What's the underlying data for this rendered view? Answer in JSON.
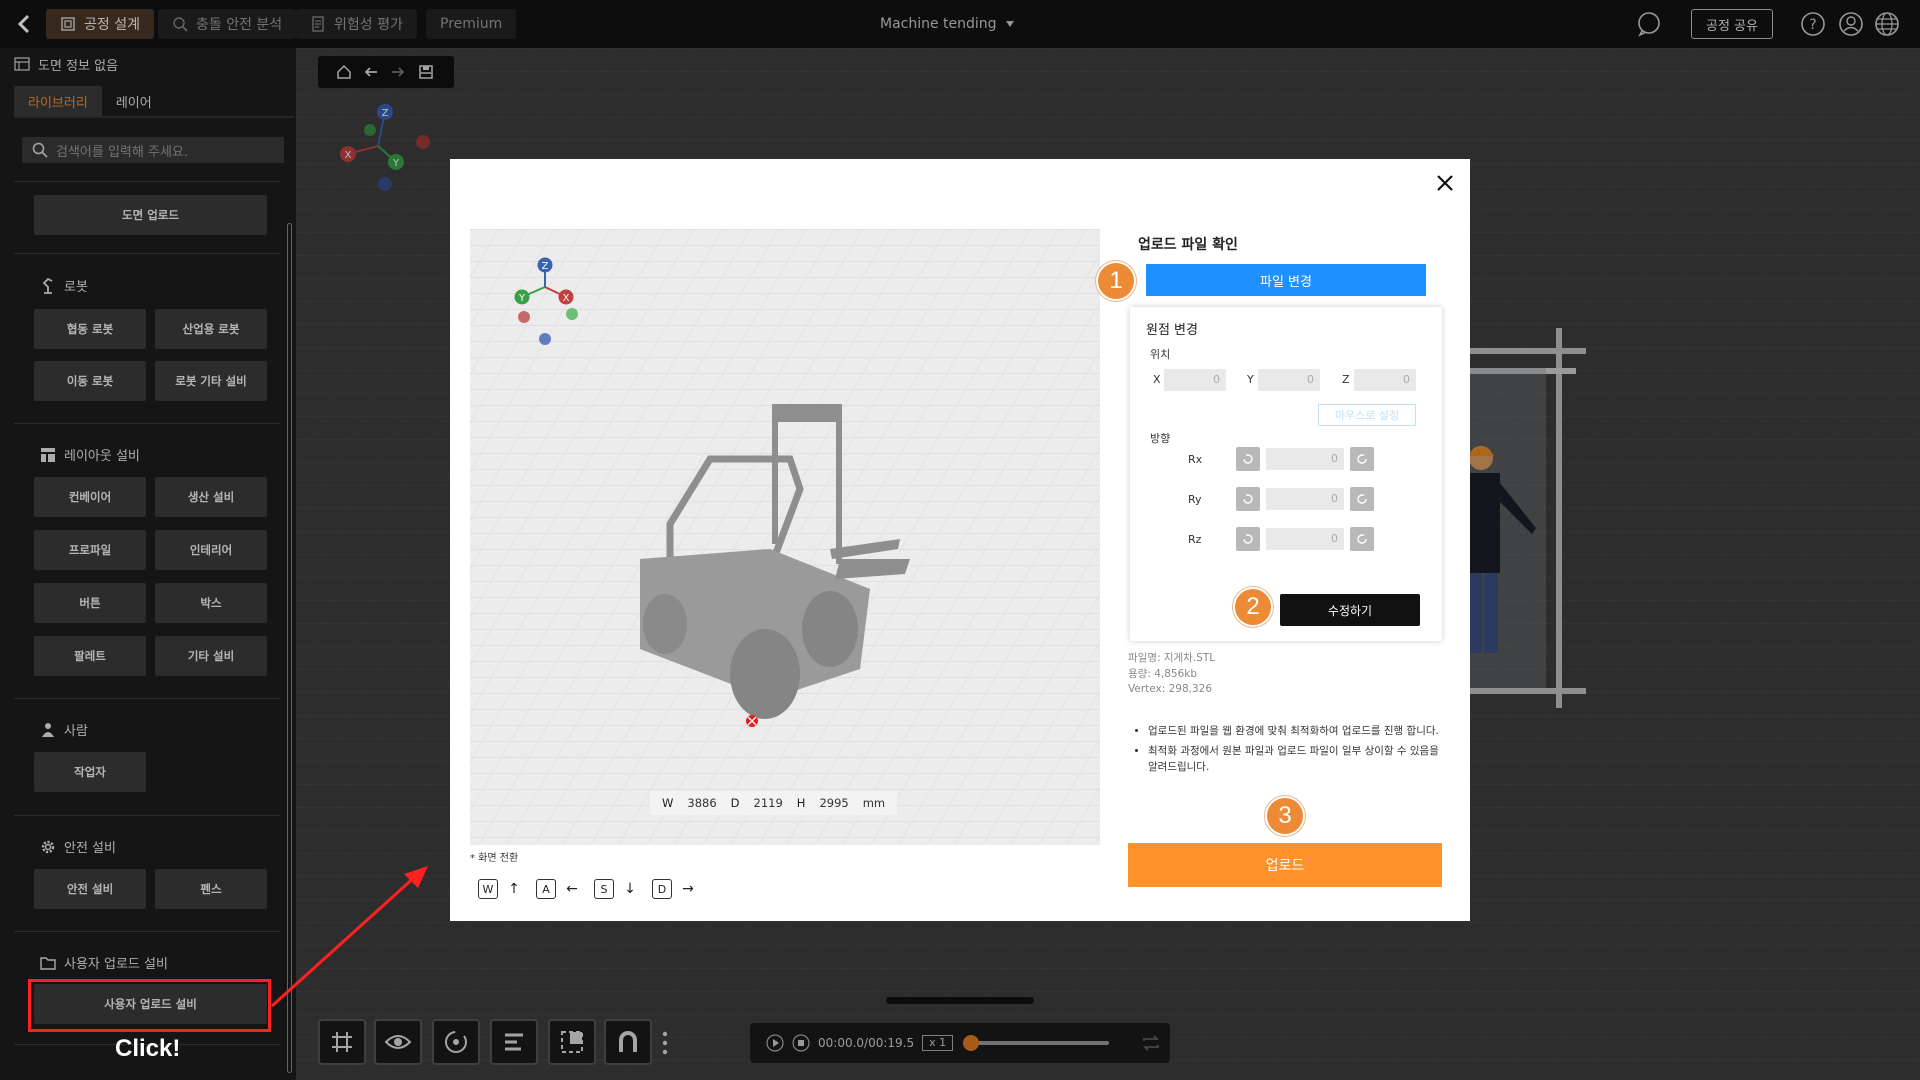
{
  "topbar": {
    "tabs": [
      {
        "label": "공정 설계",
        "icon": "process-design-icon",
        "active": true
      },
      {
        "label": "충돌 안전 분석",
        "icon": "collision-analysis-icon",
        "active": false
      },
      {
        "label": "위험성 평가",
        "icon": "risk-assessment-icon",
        "active": false
      },
      {
        "label": "Premium",
        "active": false
      }
    ],
    "project_title": "Machine tending",
    "share_label": "공정 공유",
    "icons": [
      "chat-icon",
      "help-icon",
      "user-icon",
      "globe-icon"
    ]
  },
  "sidebar": {
    "header": "도면 정보 없음",
    "tabs": [
      "라이브러리",
      "레이어"
    ],
    "active_tab": "라이브러리",
    "search_placeholder": "검색어를 입력해 주세요.",
    "upload_drawing": "도면 업로드",
    "sections": [
      {
        "title": "로봇",
        "icon": "robot-icon",
        "items": [
          "협동 로봇",
          "산업용 로봇",
          "이동 로봇",
          "로봇 기타 설비"
        ]
      },
      {
        "title": "레이아웃 설비",
        "icon": "layout-icon",
        "items": [
          "컨베이어",
          "생산 설비",
          "프로파일",
          "인테리어",
          "버튼",
          "박스",
          "팔레트",
          "기타 설비"
        ]
      },
      {
        "title": "사람",
        "icon": "person-icon",
        "items": [
          "작업자"
        ]
      },
      {
        "title": "안전 설비",
        "icon": "gear-icon",
        "items": [
          "안전 설비",
          "펜스"
        ]
      },
      {
        "title": "사용자 업로드 설비",
        "icon": "folder-icon",
        "items": [
          "사용자 업로드 설비"
        ]
      }
    ],
    "annotation": "Click!"
  },
  "playback": {
    "time": "00:00.0/00:19.5",
    "speed": "x 1",
    "progress": 0
  },
  "modal": {
    "title": "업로드 파일 확인",
    "change_file": "파일 변경",
    "origin": {
      "title": "원점 변경",
      "position_label": "위치",
      "x_label": "X",
      "y_label": "Y",
      "z_label": "Z",
      "x": "0",
      "y": "0",
      "z": "0",
      "mouse_set": "마우스로 설정",
      "orientation_label": "방향",
      "rx_label": "Rx",
      "ry_label": "Ry",
      "rz_label": "Rz",
      "rx": "0",
      "ry": "0",
      "rz": "0",
      "apply": "수정하기"
    },
    "file_info": {
      "name": "파일명: 지게차.STL",
      "size": "용량: 4,856kb",
      "vertex": "Vertex: 298,326"
    },
    "notes": [
      "업로드된 파일을 웹 환경에 맞춰 최적화하여 업로드를 진행 합니다.",
      "최적화 과정에서 원본 파일과 업로드 파일이 일부 상이할 수 있음을 알려드립니다."
    ],
    "upload": "업로드",
    "dims": {
      "w_label": "W",
      "w": "3886",
      "d_label": "D",
      "d": "2119",
      "h_label": "H",
      "h": "2995",
      "unit": "mm"
    },
    "screen_switch": "* 화면 전환",
    "keys": [
      {
        "key": "W",
        "arrow": "↑"
      },
      {
        "key": "A",
        "arrow": "←"
      },
      {
        "key": "S",
        "arrow": "↓"
      },
      {
        "key": "D",
        "arrow": "→"
      }
    ],
    "steps": [
      "1",
      "2",
      "3"
    ],
    "axis": {
      "x": "X",
      "y": "Y",
      "z": "Z"
    }
  }
}
